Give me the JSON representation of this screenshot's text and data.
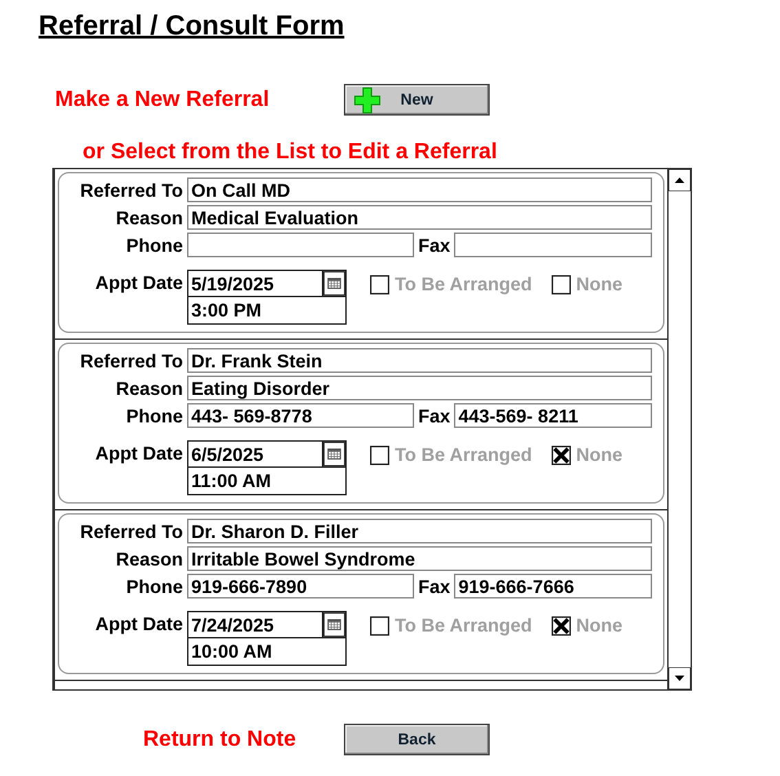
{
  "title": "Referral / Consult Form",
  "new_referral": {
    "prompt": "Make a New Referral",
    "button": "New"
  },
  "list_prompt": "or Select from the List to Edit a Referral",
  "referrals": [
    {
      "labels": [
        "Referred To",
        "Reason",
        "Phone",
        "Fax",
        "Appt Date"
      ],
      "referred_to": "On Call MD",
      "reason": "Medical Evaluation",
      "appt_date": "5/19/2025",
      "appt_time": "3:00 PM",
      "options": [
        {
          "label": "To Be Arranged",
          "checked": false
        },
        {
          "label": "None",
          "checked": false
        }
      ]
    },
    {
      "labels": [
        "Referred To",
        "Reason",
        "Phone",
        "Fax",
        "Appt Date"
      ],
      "referred_to": "Dr. Frank Stein",
      "reason": "Eating Disorder",
      "phone": "443- 569-8778",
      "fax": "443-569- 8211",
      "appt_date": "6/5/2025",
      "appt_time": "11:00 AM",
      "options": [
        {
          "label": "To Be Arranged",
          "checked": false
        },
        {
          "label": "None",
          "checked": true
        }
      ]
    },
    {
      "labels": [
        "Referred To",
        "Reason",
        "Phone",
        "Fax",
        "Appt Date"
      ],
      "referred_to": "Dr. Sharon D. Filler",
      "reason": "Irritable Bowel Syndrome",
      "phone": "919-666-7890",
      "fax": "919-666-7666",
      "appt_date": "7/24/2025",
      "appt_time": "10:00 AM",
      "options": [
        {
          "label": "To Be Arranged",
          "checked": false
        },
        {
          "label": "None",
          "checked": true
        }
      ]
    }
  ],
  "return": {
    "prompt": "Return to Note",
    "button": "Back"
  }
}
